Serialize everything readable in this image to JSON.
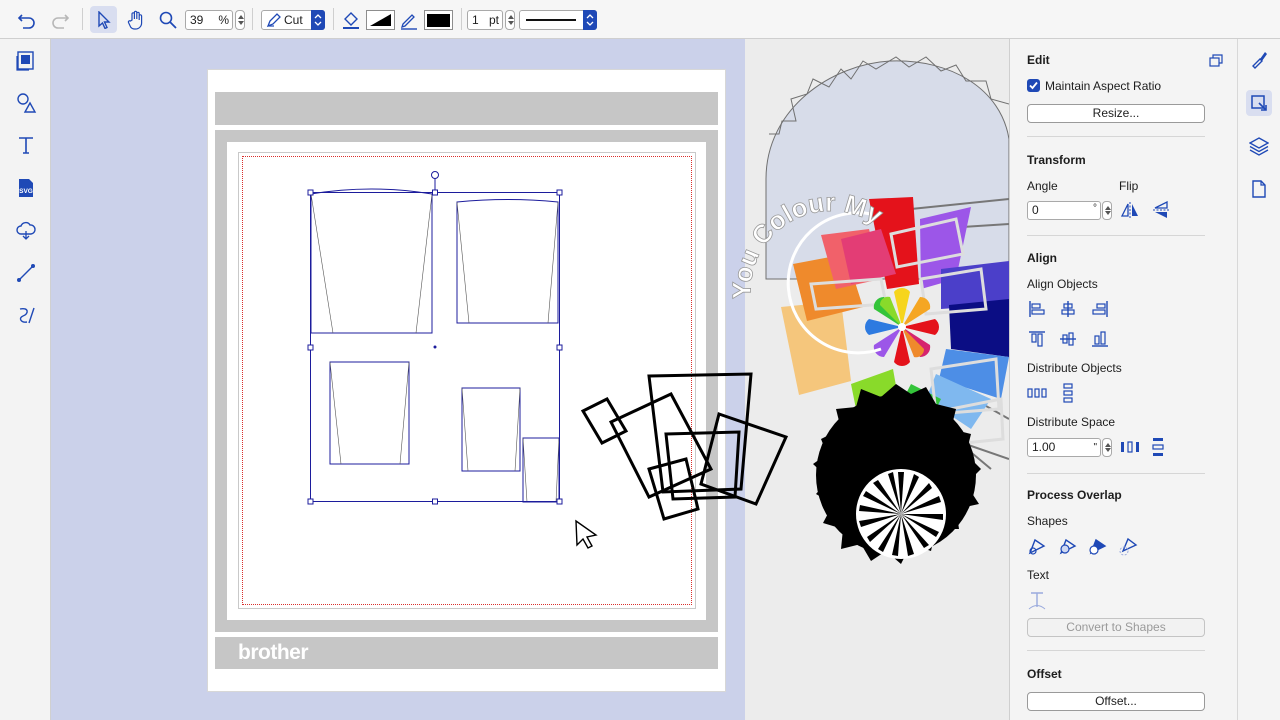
{
  "toolbar": {
    "zoom_value": "39",
    "zoom_unit": "%",
    "mode_value": "Cut",
    "stroke_width": "1",
    "stroke_unit": "pt"
  },
  "canvas": {
    "brand_text": "brother",
    "artwork_text": "You Colour My World"
  },
  "panel": {
    "edit_title": "Edit",
    "maintain_aspect_label": "Maintain Aspect Ratio",
    "maintain_aspect_checked": true,
    "resize_label": "Resize...",
    "transform_title": "Transform",
    "angle_label": "Angle",
    "angle_value": "0",
    "angle_unit": "°",
    "flip_label": "Flip",
    "align_title": "Align",
    "align_objects_label": "Align Objects",
    "distribute_objects_label": "Distribute Objects",
    "distribute_space_label": "Distribute Space",
    "distribute_space_value": "1.00",
    "distribute_space_unit": "\"",
    "process_overlap_title": "Process Overlap",
    "shapes_label": "Shapes",
    "text_label": "Text",
    "convert_to_shapes_label": "Convert to Shapes",
    "offset_title": "Offset",
    "offset_button_label": "Offset..."
  },
  "colors": {
    "canvas_bg": "#cbd1ea",
    "accent": "#1f49b6",
    "selection": "#1c1c9c",
    "cut_line": "#d9302d"
  },
  "icons": [
    "undo-icon",
    "redo-icon",
    "select-arrow-icon",
    "hand-icon",
    "zoom-icon",
    "pen-icon",
    "fill-icon",
    "line-pencil-icon",
    "image-tool-icon",
    "shapes-icon",
    "text-icon",
    "svg-icon",
    "cloud-icon",
    "line-icon",
    "curve-icon",
    "brush-icon",
    "transform-icon",
    "layers-icon",
    "page-icon"
  ]
}
